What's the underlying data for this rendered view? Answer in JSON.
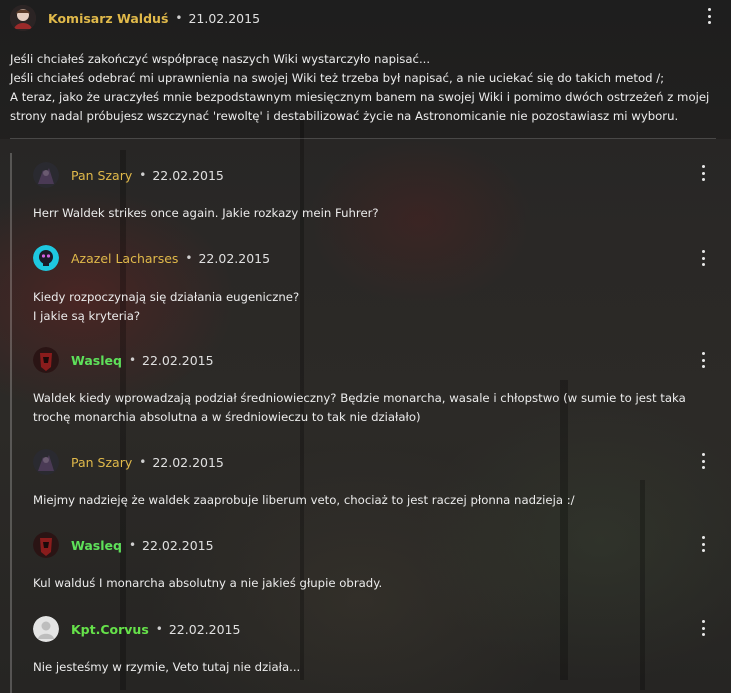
{
  "top_comment": {
    "username": "Komisarz Walduś",
    "date": "21.02.2015",
    "lines": [
      "Jeśli chciałeś zakończyć współpracę naszych Wiki wystarczyło napisać...",
      "Jeśli chciałeś odebrać mi uprawnienia na swojej Wiki też trzeba był napisać, a nie uciekać się do takich metod /;",
      "A teraz, jako że uraczyłeś mnie bezpodstawnym miesięcznym banem na swojej Wiki i pomimo dwóch ostrzeżeń z mojej",
      "strony nadal próbujesz wszczynać 'rewoltę' i  destabilizować życie na Astronomicanie nie pozostawiasz mi wyboru."
    ]
  },
  "separator": "•",
  "replies": [
    {
      "username": "Pan Szary",
      "date": "22.02.2015",
      "lines": [
        "Herr Waldek strikes once again. Jakie rozkazy mein Fuhrer?"
      ]
    },
    {
      "username": "Azazel Lacharses",
      "date": "22.02.2015",
      "lines": [
        "Kiedy rozpoczynają się działania eugeniczne?",
        "I jakie są kryteria?"
      ]
    },
    {
      "username": "Wasleq",
      "date": "22.02.2015",
      "lines": [
        "Waldek kiedy wprowadzają podział średniowieczny? Będzie monarcha, wasale i chłopstwo (w sumie to jest taka",
        "trochę monarchia absolutna a w średniowieczu to tak nie działało)"
      ]
    },
    {
      "username": "Pan Szary",
      "date": "22.02.2015",
      "lines": [
        "Miejmy nadzieję że waldek zaaprobuje liberum veto, chociaż to jest raczej płonna nadzieja :/"
      ]
    },
    {
      "username": "Wasleq",
      "date": "22.02.2015",
      "lines": [
        "Kul walduś I monarcha absolutny a nie jakieś głupie obrady."
      ]
    },
    {
      "username": "Kpt.Corvus",
      "date": "22.02.2015",
      "lines": [
        "Nie jesteśmy w rzymie, Veto tutaj nie działa..."
      ]
    }
  ],
  "colors": {
    "admin_username": "#e0b94a",
    "user_username": "#5ee05a",
    "text": "#ececec"
  }
}
